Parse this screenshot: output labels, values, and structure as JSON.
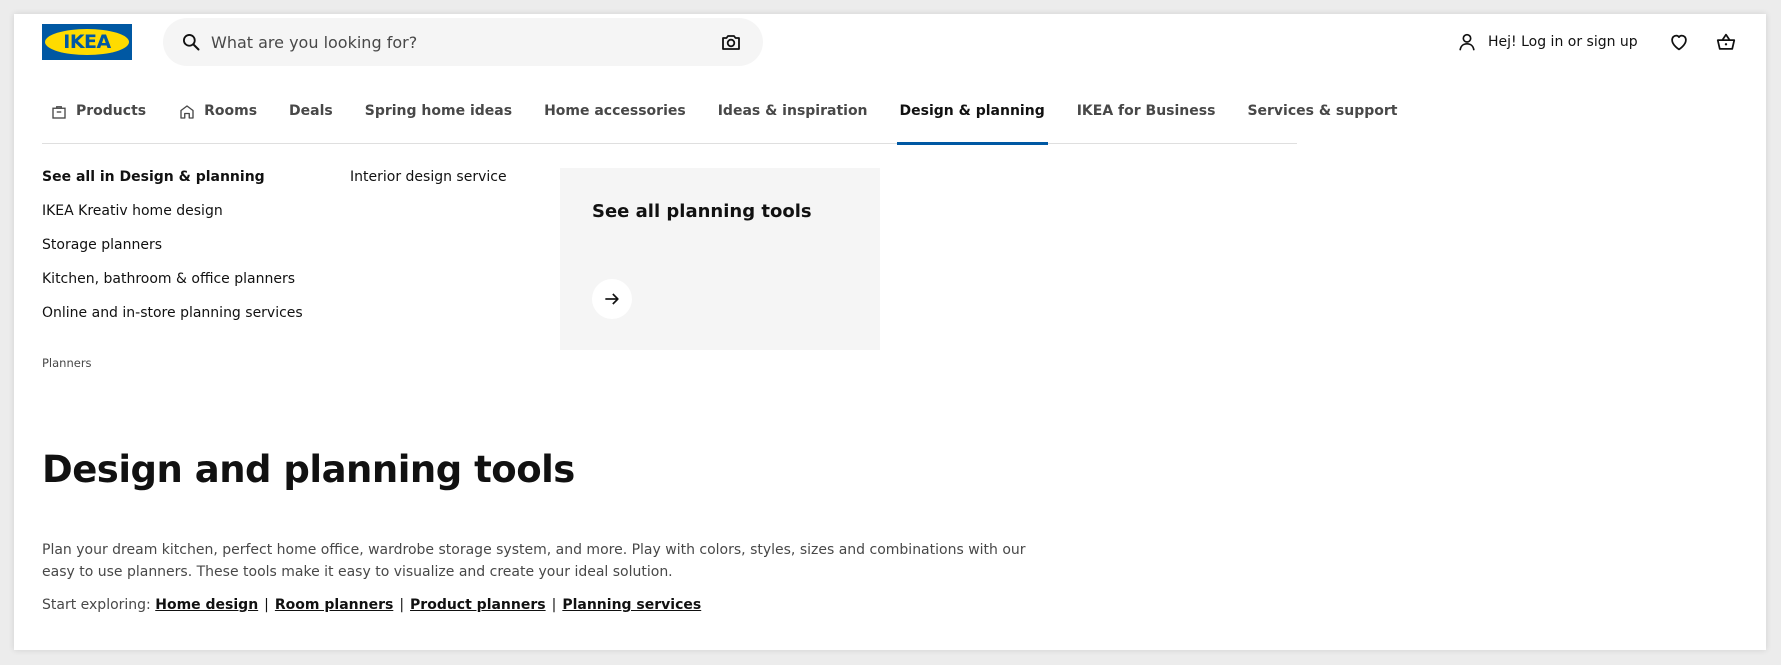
{
  "brand": {
    "logo_text": "IKEA",
    "primary_color": "#0058a3",
    "accent_color": "#ffdb00"
  },
  "search": {
    "placeholder": "What are you looking for?",
    "icon": "search-icon",
    "camera_icon": "camera-icon"
  },
  "header": {
    "login_label": "Hej! Log in or sign up",
    "user_icon": "user-icon",
    "favorites_icon": "heart-icon",
    "cart_icon": "cart-icon"
  },
  "nav": {
    "items": [
      {
        "label": "Products",
        "icon": "bag-icon",
        "active": false
      },
      {
        "label": "Rooms",
        "icon": "house-icon",
        "active": false
      },
      {
        "label": "Deals",
        "active": false
      },
      {
        "label": "Spring home ideas",
        "active": false
      },
      {
        "label": "Home accessories",
        "active": false
      },
      {
        "label": "Ideas & inspiration",
        "active": false
      },
      {
        "label": "Design & planning",
        "active": true
      },
      {
        "label": "IKEA for Business",
        "active": false
      },
      {
        "label": "Services & support",
        "active": false
      }
    ]
  },
  "menu": {
    "column1": [
      "See all in Design & planning",
      "IKEA Kreativ home design",
      "Storage planners",
      "Kitchen, bathroom & office planners",
      "Online and in-store planning services"
    ],
    "column2": [
      "Interior design service"
    ],
    "caption": "Planners",
    "tile": {
      "title": "See all planning tools",
      "icon": "arrow-right-icon"
    }
  },
  "hero": {
    "title": "Design and planning tools",
    "description": "Plan your dream kitchen, perfect home office, wardrobe storage system, and more. Play with colors, styles, sizes and combinations with our easy to use planners. These tools make it easy to visualize and create your ideal solution.",
    "explore_prefix": "Start exploring:",
    "links": [
      "Home design",
      "Room planners",
      "Product planners",
      "Planning services"
    ],
    "separator": "|"
  }
}
